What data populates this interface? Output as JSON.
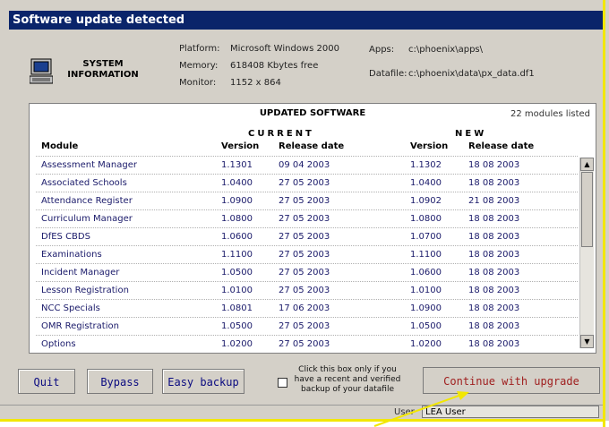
{
  "window": {
    "title": "Software update detected"
  },
  "system": {
    "title_line1": "SYSTEM",
    "title_line2": "INFORMATION",
    "platform_label": "Platform:",
    "platform": "Microsoft Windows 2000",
    "memory_label": "Memory:",
    "memory": "618408 Kbytes free",
    "monitor_label": "Monitor:",
    "monitor": "1152 x 864",
    "apps_label": "Apps:",
    "apps": "c:\\phoenix\\apps\\",
    "datafile_label": "Datafile:",
    "datafile": "c:\\phoenix\\data\\px_data.df1"
  },
  "table": {
    "title": "UPDATED SOFTWARE",
    "modules_count": "22 modules listed",
    "group_current": "CURRENT",
    "group_new": "NEW",
    "col_module": "Module",
    "col_version": "Version",
    "col_release": "Release date",
    "col_version_new": "Version",
    "col_release_new": "Release date",
    "rows": [
      {
        "module": "Assessment Manager",
        "cur_ver": "1.1301",
        "cur_date": "09 04 2003",
        "new_ver": "1.1302",
        "new_date": "18 08 2003"
      },
      {
        "module": "Associated Schools",
        "cur_ver": "1.0400",
        "cur_date": "27 05 2003",
        "new_ver": "1.0400",
        "new_date": "18 08 2003"
      },
      {
        "module": "Attendance Register",
        "cur_ver": "1.0900",
        "cur_date": "27 05 2003",
        "new_ver": "1.0902",
        "new_date": "21 08 2003"
      },
      {
        "module": "Curriculum Manager",
        "cur_ver": "1.0800",
        "cur_date": "27 05 2003",
        "new_ver": "1.0800",
        "new_date": "18 08 2003"
      },
      {
        "module": "DfES CBDS",
        "cur_ver": "1.0600",
        "cur_date": "27 05 2003",
        "new_ver": "1.0700",
        "new_date": "18 08 2003"
      },
      {
        "module": "Examinations",
        "cur_ver": "1.1100",
        "cur_date": "27 05 2003",
        "new_ver": "1.1100",
        "new_date": "18 08 2003"
      },
      {
        "module": "Incident Manager",
        "cur_ver": "1.0500",
        "cur_date": "27 05 2003",
        "new_ver": "1.0600",
        "new_date": "18 08 2003"
      },
      {
        "module": "Lesson Registration",
        "cur_ver": "1.0100",
        "cur_date": "27 05 2003",
        "new_ver": "1.0100",
        "new_date": "18 08 2003"
      },
      {
        "module": "NCC Specials",
        "cur_ver": "1.0801",
        "cur_date": "17 06 2003",
        "new_ver": "1.0900",
        "new_date": "18 08 2003"
      },
      {
        "module": "OMR Registration",
        "cur_ver": "1.0500",
        "cur_date": "27 05 2003",
        "new_ver": "1.0500",
        "new_date": "18 08 2003"
      },
      {
        "module": "Options",
        "cur_ver": "1.0200",
        "cur_date": "27 05 2003",
        "new_ver": "1.0200",
        "new_date": "18 08 2003"
      }
    ]
  },
  "buttons": {
    "quit": "Quit",
    "bypass": "Bypass",
    "easy_backup": "Easy backup",
    "continue": "Continue with upgrade"
  },
  "backup_note": {
    "line1": "Click this box only if you",
    "line2": "have a recent and verified",
    "line3": "backup of your datafile"
  },
  "status": {
    "user_label": "User",
    "user_value": "LEA User"
  },
  "icons": {
    "system": "computer-icon",
    "scroll_up": "scroll-up-icon",
    "scroll_down": "scroll-down-icon",
    "annotation": "yellow-arrow-icon"
  },
  "colors": {
    "title_bar": "#0a246a",
    "highlight": "#f2e700",
    "continue_text": "#a02020"
  }
}
